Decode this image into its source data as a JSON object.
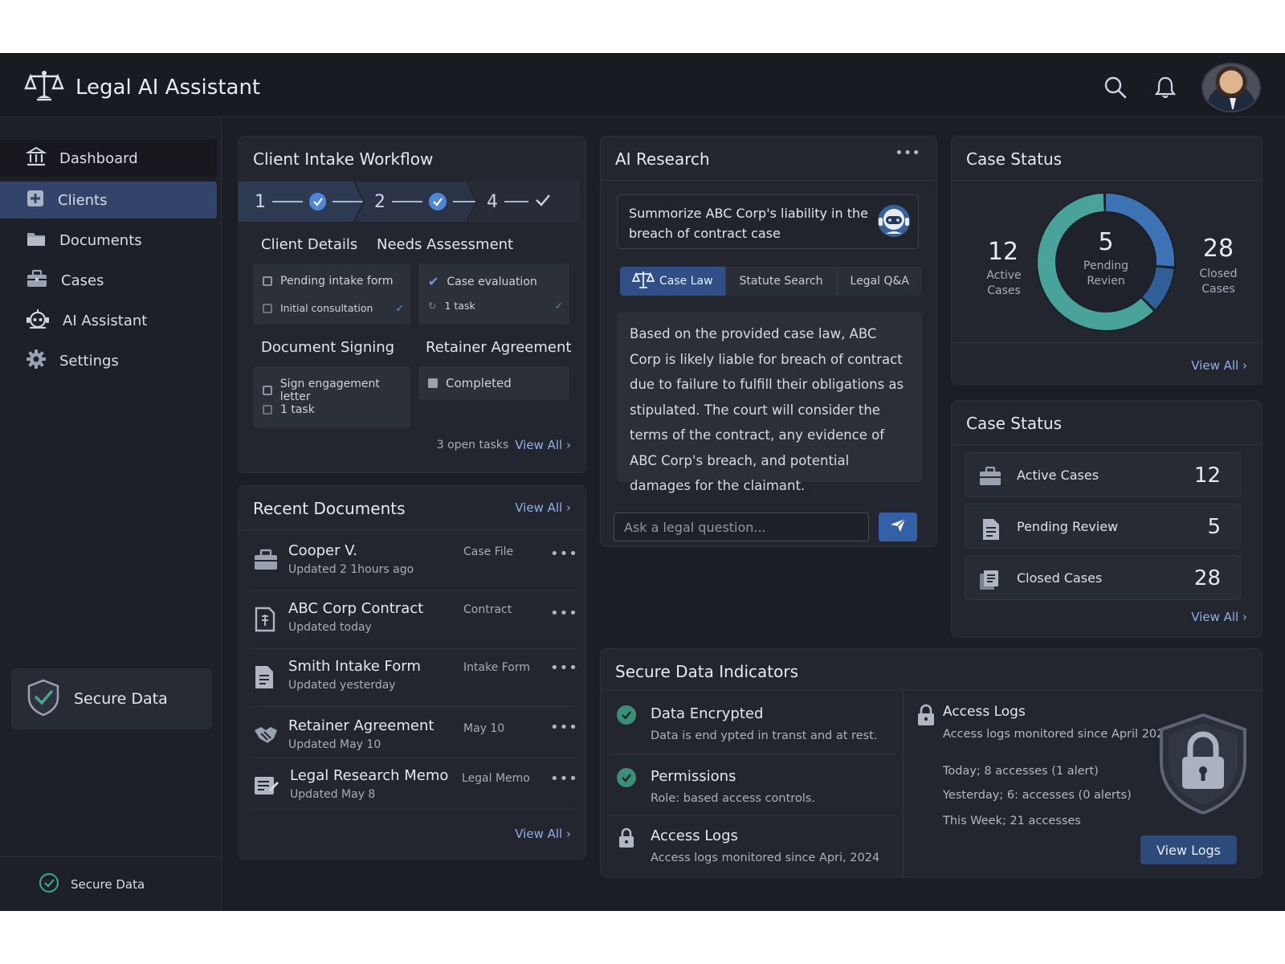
{
  "app": {
    "title": "Legal AI Assistant"
  },
  "sidebar": {
    "items": [
      {
        "label": "Dashboard",
        "icon": "bank-icon"
      },
      {
        "label": "Clients",
        "icon": "plus-square-icon"
      },
      {
        "label": "Documents",
        "icon": "folder-icon"
      },
      {
        "label": "Cases",
        "icon": "briefcase-icon"
      },
      {
        "label": "AI Assistant",
        "icon": "robot-icon"
      },
      {
        "label": "Settings",
        "icon": "gear-icon"
      }
    ],
    "secure_card": "Secure Data",
    "footer": "Secure Data"
  },
  "workflow": {
    "title": "Client Intake Workflow",
    "steps": [
      "1",
      "2",
      "4"
    ],
    "client_details": "Client Details",
    "needs_assessment": "Needs Assessment",
    "box1": {
      "row1": "Pending intake form",
      "row2": "Initial consultation"
    },
    "box2": {
      "row1": "Case evaluation",
      "row2": "1 task"
    },
    "document_signing": "Document Signing",
    "retainer_agreement": "Retainer Agreement",
    "box3": {
      "row1": "Sign engagement letter",
      "row2": "1 task"
    },
    "box4": {
      "row1": "Completed"
    },
    "open_tasks": "3 open tasks",
    "view_all": "View All"
  },
  "recent_documents": {
    "title": "Recent Documents",
    "view_all": "View All",
    "items": [
      {
        "name": "Cooper V.",
        "updated": "Updated 2 1hours ago",
        "type": "Case File",
        "icon": "briefcase-icon"
      },
      {
        "name": "ABC Corp Contract",
        "updated": "Updated today",
        "type": "Contract",
        "icon": "contract-icon"
      },
      {
        "name": "Smith Intake Form",
        "updated": "Updated yesterday",
        "type": "Intake Form",
        "icon": "document-icon"
      },
      {
        "name": "Retainer Agreement",
        "updated": "Updated May 10",
        "type": "May 10",
        "icon": "handshake-icon"
      },
      {
        "name": "Legal Research Memo",
        "updated": "Updated May 8",
        "type": "Legal Memo",
        "icon": "memo-icon"
      }
    ],
    "footer_link": "View All"
  },
  "ai_research": {
    "title": "AI Research",
    "query": "Summorize ABC Corp's liability in the breach of contract case",
    "tabs": [
      "Case Law",
      "Statute Search",
      "Legal Q&A"
    ],
    "answer": "Based on the provided case law, ABC Corp is likely liable for breach of contract due to failure to fulfill their obligations as stipulated. The court will consider the terms of the contract, any evidence of ABC Corp's breach, and potential damages for the claimant.",
    "placeholder": "Ask a legal question..."
  },
  "case_status_chart": {
    "title": "Case Status",
    "active_value": "12",
    "active_label": "Active Cases",
    "pending_value": "5",
    "pending_label": "Pending Revien",
    "closed_value": "28",
    "closed_label": "Closed Cases",
    "view_all": "View All",
    "segments": [
      {
        "name": "Active",
        "value": 12,
        "color": "#3d73b4"
      },
      {
        "name": "Pending",
        "value": 5,
        "color": "#2f5f96"
      },
      {
        "name": "Closed",
        "value": 28,
        "color": "#4aa39a"
      }
    ]
  },
  "case_status_list": {
    "title": "Case Status",
    "rows": [
      {
        "label": "Active Cases",
        "value": "12",
        "icon": "briefcase-icon"
      },
      {
        "label": "Pending Review",
        "value": "5",
        "icon": "document-icon"
      },
      {
        "label": "Closed Cases",
        "value": "28",
        "icon": "stacked-docs-icon"
      }
    ],
    "view_all": "View All"
  },
  "secure_data": {
    "title": "Secure Data Indicators",
    "items": [
      {
        "title": "Data Encrypted",
        "desc": "Data is end ypted in transt and at rest."
      },
      {
        "title": "Permissions",
        "desc": "Role: based access controls."
      },
      {
        "title": "Access Logs",
        "desc": "Access logs monitored since Apri, 2024"
      }
    ],
    "access_logs": {
      "title": "Access Logs",
      "desc": "Access logs monitored since April 2024",
      "lines": [
        "Today; 8 accesses (1 alert)",
        "Yesterday; 6: accesses (0 alerts)",
        "This Week; 21 accesses"
      ]
    },
    "button": "View Logs"
  }
}
